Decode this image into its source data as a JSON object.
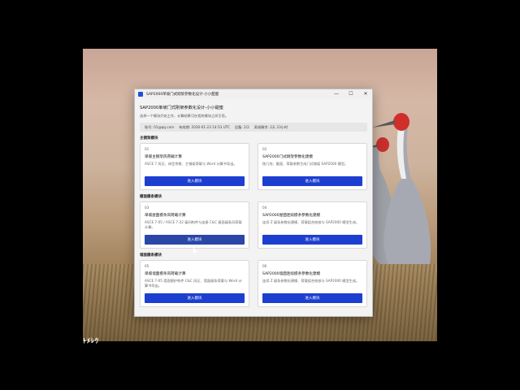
{
  "window": {
    "title": "SAP2000单坡门式刚架参数化设计-小小甜蜜",
    "controls": [
      "—",
      "☐",
      "✕"
    ]
  },
  "header": {
    "title": "SAP2000单坡门式刚架参数化设计-小小甜蜜",
    "subtitle": "选择一个模块开始工作，计算结果可在相关模块之间引用。"
  },
  "info": {
    "account": "账号: 01@qq.com",
    "expiry": "有效期: 2030-01-23 14:53 UTC",
    "devices": "设备: 2/2",
    "offline": "离线剩余: 2天 23小时"
  },
  "sections": [
    {
      "label": "主钢架模块",
      "cards": [
        {
          "num": "01",
          "title": "单坡主钢架风荷载计算",
          "desc": "ASCE 7 风压、体型系数、主钢架荷载与 Word 计算书导出。",
          "button": "进入模块"
        },
        {
          "num": "02",
          "title": "SAP2000门式刚架参数化建模",
          "desc": "按几何、截面、荷载参数生成门式刚架 SAP2000 模型。",
          "button": "进入模块"
        }
      ]
    },
    {
      "label": "檩面檩条模块",
      "cards": [
        {
          "num": "03",
          "title": "单坡屋面檩条风荷载计算",
          "desc": "ASCE 7-05 / ASCE 7-22 檩间构件与连接 C&C 屋面檩条风荷载计算。",
          "button": "进入模块"
        },
        {
          "num": "04",
          "title": "SAP2000屋面连续檩条参数化建模",
          "desc": "连续 Z 檩条参数化建模、荷载组合校核与 SAP2000 模型生成。",
          "button": "进入模块"
        }
      ]
    },
    {
      "label": "墙面檩条模块",
      "cards": [
        {
          "num": "05",
          "title": "单坡墙面檩条风荷载计算",
          "desc": "ASCE 7-05 墙面围护构件 C&C 风压、墙面檩条荷载与 Word 计算书导出。",
          "button": "进入模块"
        },
        {
          "num": "06",
          "title": "SAP2000墙面连续檩条参数化建模",
          "desc": "连续 Z 檩条参数化建模、荷载组合校核与 SAP2000 模型生成。",
          "button": "进入模块"
        }
      ]
    }
  ],
  "desktop_text": "ﾄﾒﾚｳ",
  "colors": {
    "accent": "#1d3fd0",
    "accent_hover": "#2a47a8"
  }
}
